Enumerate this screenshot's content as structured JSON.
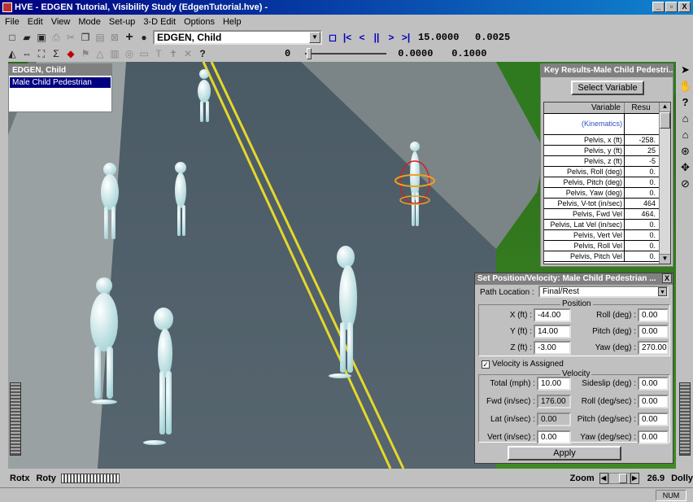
{
  "window": {
    "title": "HVE - EDGEN Tutorial, Visibility Study (EdgenTutorial.hve) -",
    "min": "_",
    "max": "▫",
    "close": "X"
  },
  "menu": [
    "File",
    "Edit",
    "View",
    "Mode",
    "Set-up",
    "3-D Edit",
    "Options",
    "Help"
  ],
  "toolbar": {
    "object_combo": "EDGEN, Child",
    "time": "15.0000",
    "step": "0.0025",
    "frame": "0",
    "sim_time": "0.0000",
    "sim_step": "0.1000"
  },
  "object_list": {
    "header": "EDGEN, Child",
    "selected": "Male Child Pedestrian"
  },
  "key_results": {
    "title": "Key Results-Male Child Pedestri...",
    "select_button": "Select Variable",
    "col_variable": "Variable",
    "col_result": "Resu",
    "group": "(Kinematics)",
    "rows": [
      {
        "v": "Pelvis, x (ft)",
        "r": "-258."
      },
      {
        "v": "Pelvis, y (ft)",
        "r": "25"
      },
      {
        "v": "Pelvis, z (ft)",
        "r": "-5"
      },
      {
        "v": "Pelvis, Roll (deg)",
        "r": "0."
      },
      {
        "v": "Pelvis, Pitch (deg)",
        "r": "0."
      },
      {
        "v": "Pelvis, Yaw (deg)",
        "r": "0."
      },
      {
        "v": "Pelvis, V-tot (in/sec)",
        "r": "464"
      },
      {
        "v": "Pelvis, Fwd Vel",
        "r": "464."
      },
      {
        "v": "Pelvis, Lat Vel (in/sec)",
        "r": "0."
      },
      {
        "v": "Pelvis, Vert Vel",
        "r": "0."
      },
      {
        "v": "Pelvis, Roll Vel",
        "r": "0."
      },
      {
        "v": "Pelvis, Pitch Vel",
        "r": "0."
      }
    ]
  },
  "setpos": {
    "title": "Set Position/Velocity: Male Child Pedestrian ...",
    "close": "X",
    "path_label": "Path Location :",
    "path_value": "Final/Rest",
    "position_group": "Position",
    "x_label": "X (ft) :",
    "x_val": "-44.00",
    "y_label": "Y (ft) :",
    "y_val": "14.00",
    "z_label": "Z (ft) :",
    "z_val": "-3.00",
    "roll_label": "Roll (deg) :",
    "roll_val": "0.00",
    "pitch_label": "Pitch (deg) :",
    "pitch_val": "0.00",
    "yaw_label": "Yaw (deg) :",
    "yaw_val": "270.00",
    "vel_check": "Velocity is Assigned",
    "velocity_group": "Velocity",
    "total_label": "Total (mph) :",
    "total_val": "10.00",
    "fwd_label": "Fwd (in/sec) :",
    "fwd_val": "176.00",
    "lat_label": "Lat (in/sec) :",
    "lat_val": "0.00",
    "vert_label": "Vert (in/sec) :",
    "vert_val": "0.00",
    "sideslip_label": "Sideslip (deg) :",
    "sideslip_val": "0.00",
    "rollv_label": "Roll (deg/sec) :",
    "rollv_val": "0.00",
    "pitchv_label": "Pitch (deg/sec) :",
    "pitchv_val": "0.00",
    "yawv_label": "Yaw (deg/sec) :",
    "yawv_val": "0.00",
    "apply": "Apply"
  },
  "bottom": {
    "rotx": "Rotx",
    "roty": "Roty",
    "zoom": "Zoom",
    "zoom_value": "26.9",
    "dolly": "Dolly"
  },
  "status": {
    "num": "NUM"
  }
}
